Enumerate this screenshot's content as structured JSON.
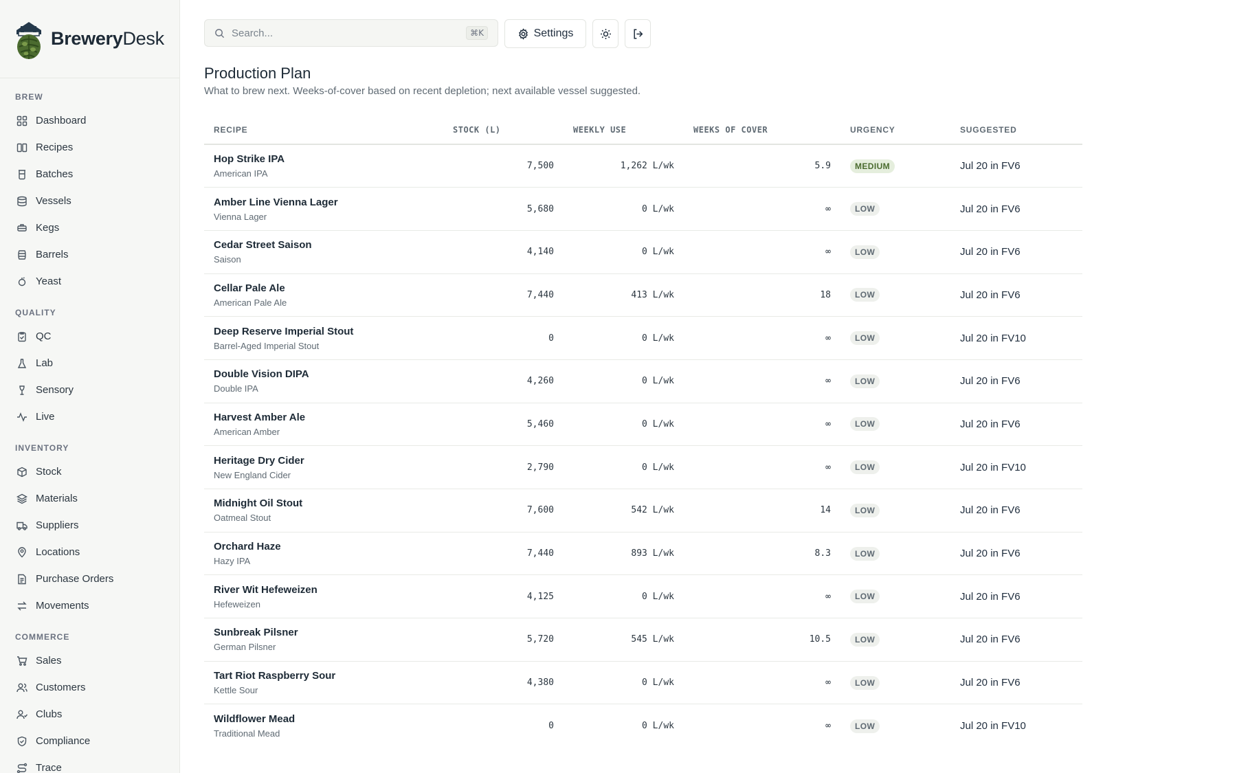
{
  "brand": {
    "name_part1": "Brewery",
    "name_part2": "Desk"
  },
  "sidebar": {
    "sections": [
      {
        "title": "BREW",
        "items": [
          {
            "label": "Dashboard",
            "icon": "grid-icon"
          },
          {
            "label": "Recipes",
            "icon": "book-icon"
          },
          {
            "label": "Batches",
            "icon": "beaker-icon"
          },
          {
            "label": "Vessels",
            "icon": "database-icon"
          },
          {
            "label": "Kegs",
            "icon": "keg-icon"
          },
          {
            "label": "Barrels",
            "icon": "barrel-icon"
          },
          {
            "label": "Yeast",
            "icon": "yeast-icon"
          }
        ]
      },
      {
        "title": "QUALITY",
        "items": [
          {
            "label": "QC",
            "icon": "clipboard-check-icon"
          },
          {
            "label": "Lab",
            "icon": "flask-icon"
          },
          {
            "label": "Sensory",
            "icon": "wine-glass-icon"
          },
          {
            "label": "Live",
            "icon": "activity-icon"
          }
        ]
      },
      {
        "title": "INVENTORY",
        "items": [
          {
            "label": "Stock",
            "icon": "package-icon"
          },
          {
            "label": "Materials",
            "icon": "layers-icon"
          },
          {
            "label": "Suppliers",
            "icon": "truck-icon"
          },
          {
            "label": "Locations",
            "icon": "map-pin-icon"
          },
          {
            "label": "Purchase Orders",
            "icon": "file-text-icon"
          },
          {
            "label": "Movements",
            "icon": "arrows-exchange-icon"
          }
        ]
      },
      {
        "title": "COMMERCE",
        "items": [
          {
            "label": "Sales",
            "icon": "cart-icon"
          },
          {
            "label": "Customers",
            "icon": "users-icon"
          },
          {
            "label": "Clubs",
            "icon": "user-group-icon"
          },
          {
            "label": "Compliance",
            "icon": "shield-check-icon"
          },
          {
            "label": "Trace",
            "icon": "route-icon"
          }
        ]
      }
    ]
  },
  "topbar": {
    "search_placeholder": "Search...",
    "search_shortcut": "⌘K",
    "settings_label": "Settings"
  },
  "page": {
    "title": "Production Plan",
    "subtitle": "What to brew next. Weeks-of-cover based on recent depletion; next available vessel suggested."
  },
  "table": {
    "headers": [
      "RECIPE",
      "STOCK (L)",
      "WEEKLY USE",
      "WEEKS OF COVER",
      "URGENCY",
      "SUGGESTED"
    ],
    "rows": [
      {
        "name": "Hop Strike IPA",
        "style": "American IPA",
        "stock": "7,500",
        "weekly": "1,262 L/wk",
        "cover": "5.9",
        "urgency": "MEDIUM",
        "suggested": "Jul 20 in FV6"
      },
      {
        "name": "Amber Line Vienna Lager",
        "style": "Vienna Lager",
        "stock": "5,680",
        "weekly": "0 L/wk",
        "cover": "∞",
        "urgency": "LOW",
        "suggested": "Jul 20 in FV6"
      },
      {
        "name": "Cedar Street Saison",
        "style": "Saison",
        "stock": "4,140",
        "weekly": "0 L/wk",
        "cover": "∞",
        "urgency": "LOW",
        "suggested": "Jul 20 in FV6"
      },
      {
        "name": "Cellar Pale Ale",
        "style": "American Pale Ale",
        "stock": "7,440",
        "weekly": "413 L/wk",
        "cover": "18",
        "urgency": "LOW",
        "suggested": "Jul 20 in FV6"
      },
      {
        "name": "Deep Reserve Imperial Stout",
        "style": "Barrel-Aged Imperial Stout",
        "stock": "0",
        "weekly": "0 L/wk",
        "cover": "∞",
        "urgency": "LOW",
        "suggested": "Jul 20 in FV10"
      },
      {
        "name": "Double Vision DIPA",
        "style": "Double IPA",
        "stock": "4,260",
        "weekly": "0 L/wk",
        "cover": "∞",
        "urgency": "LOW",
        "suggested": "Jul 20 in FV6"
      },
      {
        "name": "Harvest Amber Ale",
        "style": "American Amber",
        "stock": "5,460",
        "weekly": "0 L/wk",
        "cover": "∞",
        "urgency": "LOW",
        "suggested": "Jul 20 in FV6"
      },
      {
        "name": "Heritage Dry Cider",
        "style": "New England Cider",
        "stock": "2,790",
        "weekly": "0 L/wk",
        "cover": "∞",
        "urgency": "LOW",
        "suggested": "Jul 20 in FV10"
      },
      {
        "name": "Midnight Oil Stout",
        "style": "Oatmeal Stout",
        "stock": "7,600",
        "weekly": "542 L/wk",
        "cover": "14",
        "urgency": "LOW",
        "suggested": "Jul 20 in FV6"
      },
      {
        "name": "Orchard Haze",
        "style": "Hazy IPA",
        "stock": "7,440",
        "weekly": "893 L/wk",
        "cover": "8.3",
        "urgency": "LOW",
        "suggested": "Jul 20 in FV6"
      },
      {
        "name": "River Wit Hefeweizen",
        "style": "Hefeweizen",
        "stock": "4,125",
        "weekly": "0 L/wk",
        "cover": "∞",
        "urgency": "LOW",
        "suggested": "Jul 20 in FV6"
      },
      {
        "name": "Sunbreak Pilsner",
        "style": "German Pilsner",
        "stock": "5,720",
        "weekly": "545 L/wk",
        "cover": "10.5",
        "urgency": "LOW",
        "suggested": "Jul 20 in FV6"
      },
      {
        "name": "Tart Riot Raspberry Sour",
        "style": "Kettle Sour",
        "stock": "4,380",
        "weekly": "0 L/wk",
        "cover": "∞",
        "urgency": "LOW",
        "suggested": "Jul 20 in FV6"
      },
      {
        "name": "Wildflower Mead",
        "style": "Traditional Mead",
        "stock": "0",
        "weekly": "0 L/wk",
        "cover": "∞",
        "urgency": "LOW",
        "suggested": "Jul 20 in FV10"
      }
    ]
  },
  "colors": {
    "brand_green": "#3d5a2a",
    "badge_medium_bg": "#e5eedd",
    "badge_low_bg": "#eef0ec",
    "text_dark": "#1d2a36"
  }
}
